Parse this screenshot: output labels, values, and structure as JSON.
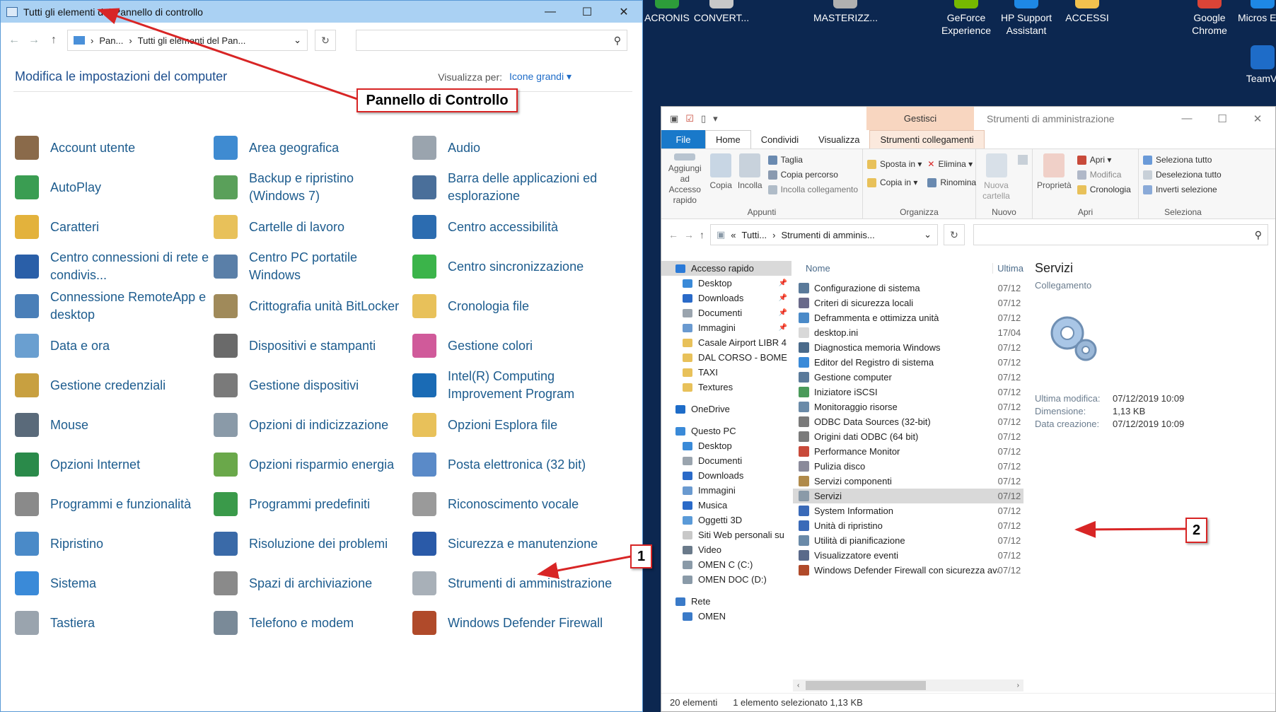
{
  "desktop_icons": [
    {
      "label": "ACRONIS",
      "color": "#2d9d3a"
    },
    {
      "label": "CONVERT...",
      "color": "#c8c8c8"
    },
    {
      "label": "MASTERIZZ...",
      "color": "#b0b0b0"
    },
    {
      "label": "GeForce Experience",
      "color": "#76b900"
    },
    {
      "label": "HP Support Assistant",
      "color": "#1e88e5"
    },
    {
      "label": "ACCESSI",
      "color": "#f2c14e"
    },
    {
      "label": "Google Chrome",
      "color": "#db4437"
    },
    {
      "label": "Micros Edg",
      "color": "#1e88e5"
    },
    {
      "label": "TeamVi",
      "color": "#1e6cc8"
    }
  ],
  "control_panel": {
    "title": "Tutti gli elementi del Pannello di controllo",
    "window_buttons": [
      "—",
      "☐",
      "✕"
    ],
    "breadcrumb": [
      "Pan...",
      "Tutti gli elementi del Pan..."
    ],
    "heading": "Modifica le impostazioni del computer",
    "view_label": "Visualizza per:",
    "view_value": "Icone grandi",
    "items": [
      {
        "label": "Account utente",
        "color": "#8a6a4a"
      },
      {
        "label": "Area geografica",
        "color": "#3f8bd1"
      },
      {
        "label": "Audio",
        "color": "#9aa4ae"
      },
      {
        "label": "AutoPlay",
        "color": "#3a9d52"
      },
      {
        "label": "Backup e ripristino (Windows 7)",
        "color": "#5aa05a"
      },
      {
        "label": "Barra delle applicazioni ed esplorazione",
        "color": "#4a6f9a"
      },
      {
        "label": "Caratteri",
        "color": "#e3b23c"
      },
      {
        "label": "Cartelle di lavoro",
        "color": "#e8c15a"
      },
      {
        "label": "Centro accessibilità",
        "color": "#2c6cb0"
      },
      {
        "label": "Centro connessioni di rete e condivis...",
        "color": "#2a5fa8"
      },
      {
        "label": "Centro PC portatile Windows",
        "color": "#5a7fa8"
      },
      {
        "label": "Centro sincronizzazione",
        "color": "#3bb44a"
      },
      {
        "label": "Connessione RemoteApp e desktop",
        "color": "#4a7fb8"
      },
      {
        "label": "Crittografia unità BitLocker",
        "color": "#a08a5a"
      },
      {
        "label": "Cronologia file",
        "color": "#e8c15a"
      },
      {
        "label": "Data e ora",
        "color": "#6a9fd0"
      },
      {
        "label": "Dispositivi e stampanti",
        "color": "#6a6a6a"
      },
      {
        "label": "Gestione colori",
        "color": "#d05a9a"
      },
      {
        "label": "Gestione credenziali",
        "color": "#c8a040"
      },
      {
        "label": "Gestione dispositivi",
        "color": "#7a7a7a"
      },
      {
        "label": "Intel(R) Computing Improvement Program",
        "color": "#1a6bb5"
      },
      {
        "label": "Mouse",
        "color": "#5a6a7a"
      },
      {
        "label": "Opzioni di indicizzazione",
        "color": "#8a9aa8"
      },
      {
        "label": "Opzioni Esplora file",
        "color": "#e8c15a"
      },
      {
        "label": "Opzioni Internet",
        "color": "#2a8a4a"
      },
      {
        "label": "Opzioni risparmio energia",
        "color": "#6aa84a"
      },
      {
        "label": "Posta elettronica (32 bit)",
        "color": "#5a8ac8"
      },
      {
        "label": "Programmi e funzionalità",
        "color": "#8a8a8a"
      },
      {
        "label": "Programmi predefiniti",
        "color": "#3a9a4a"
      },
      {
        "label": "Riconoscimento vocale",
        "color": "#9a9a9a"
      },
      {
        "label": "Ripristino",
        "color": "#4a8ac8"
      },
      {
        "label": "Risoluzione dei problemi",
        "color": "#3a6aa8"
      },
      {
        "label": "Sicurezza e manutenzione",
        "color": "#2a5aa8"
      },
      {
        "label": "Sistema",
        "color": "#3a8ad8"
      },
      {
        "label": "Spazi di archiviazione",
        "color": "#8a8a8a"
      },
      {
        "label": "Strumenti di amministrazione",
        "color": "#a8b0b8"
      },
      {
        "label": "Tastiera",
        "color": "#9aa4ae"
      },
      {
        "label": "Telefono e modem",
        "color": "#7a8a98"
      },
      {
        "label": "Windows Defender Firewall",
        "color": "#b04a2a"
      }
    ]
  },
  "explorer": {
    "quick_access_icons": [
      "folder-icon",
      "check-icon",
      "page-icon",
      "dropdown-icon"
    ],
    "contextual_tab": "Gestisci",
    "title": "Strumenti di amministrazione",
    "tabs": [
      "File",
      "Home",
      "Condividi",
      "Visualizza",
      "Strumenti collegamenti"
    ],
    "ribbon": {
      "appunti": {
        "group": "Appunti",
        "pin": "Aggiungi ad Accesso rapido",
        "copia": "Copia",
        "incolla": "Incolla",
        "taglia": "Taglia",
        "copia_percorso": "Copia percorso",
        "incolla_collegamento": "Incolla collegamento"
      },
      "organizza": {
        "group": "Organizza",
        "sposta": "Sposta in ▾",
        "copia_in": "Copia in ▾",
        "elimina": "Elimina ▾",
        "rinomina": "Rinomina"
      },
      "nuovo": {
        "group": "Nuovo",
        "nuova_cartella": "Nuova cartella"
      },
      "apri": {
        "group": "Apri",
        "proprieta": "Proprietà",
        "apri": "Apri ▾",
        "modifica": "Modifica",
        "cronologia": "Cronologia"
      },
      "seleziona": {
        "group": "Seleziona",
        "tutto": "Seleziona tutto",
        "deseleziona": "Deseleziona tutto",
        "inverti": "Inverti selezione"
      }
    },
    "breadcrumb": [
      "«",
      "Tutti...",
      "Strumenti di amminis..."
    ],
    "tree": [
      {
        "label": "Accesso rapido",
        "indent": 1,
        "sel": true,
        "color": "#2a7ad8",
        "pin": ""
      },
      {
        "label": "Desktop",
        "indent": 2,
        "color": "#3a8ad8",
        "pin": "📌"
      },
      {
        "label": "Downloads",
        "indent": 2,
        "color": "#2a6ac8",
        "pin": "📌"
      },
      {
        "label": "Documenti",
        "indent": 2,
        "color": "#9aa4ae",
        "pin": "📌"
      },
      {
        "label": "Immagini",
        "indent": 2,
        "color": "#6a9ad0",
        "pin": "📌"
      },
      {
        "label": "Casale Airport LIBR 4",
        "indent": 2,
        "color": "#e8c15a",
        "pin": ""
      },
      {
        "label": "DAL CORSO - BOME",
        "indent": 2,
        "color": "#e8c15a",
        "pin": ""
      },
      {
        "label": "TAXI",
        "indent": 2,
        "color": "#e8c15a",
        "pin": ""
      },
      {
        "label": "Textures",
        "indent": 2,
        "color": "#e8c15a",
        "pin": ""
      },
      {
        "label": "",
        "indent": 0,
        "color": "",
        "pin": "",
        "spacer": true
      },
      {
        "label": "OneDrive",
        "indent": 1,
        "color": "#1e6cc8",
        "pin": ""
      },
      {
        "label": "",
        "indent": 0,
        "color": "",
        "pin": "",
        "spacer": true
      },
      {
        "label": "Questo PC",
        "indent": 1,
        "color": "#3a8ad8",
        "pin": ""
      },
      {
        "label": "Desktop",
        "indent": 2,
        "color": "#3a8ad8",
        "pin": ""
      },
      {
        "label": "Documenti",
        "indent": 2,
        "color": "#9aa4ae",
        "pin": ""
      },
      {
        "label": "Downloads",
        "indent": 2,
        "color": "#2a6ac8",
        "pin": ""
      },
      {
        "label": "Immagini",
        "indent": 2,
        "color": "#6a9ad0",
        "pin": ""
      },
      {
        "label": "Musica",
        "indent": 2,
        "color": "#2a6ac8",
        "pin": ""
      },
      {
        "label": "Oggetti 3D",
        "indent": 2,
        "color": "#5a9ad8",
        "pin": ""
      },
      {
        "label": "Siti Web personali su",
        "indent": 2,
        "color": "#c8c8c8",
        "pin": ""
      },
      {
        "label": "Video",
        "indent": 2,
        "color": "#6a7a8a",
        "pin": ""
      },
      {
        "label": "OMEN C (C:)",
        "indent": 2,
        "color": "#8a9aa8",
        "pin": ""
      },
      {
        "label": "OMEN DOC (D:)",
        "indent": 2,
        "color": "#8a9aa8",
        "pin": ""
      },
      {
        "label": "",
        "indent": 0,
        "color": "",
        "pin": "",
        "spacer": true
      },
      {
        "label": "Rete",
        "indent": 1,
        "color": "#3a7ac8",
        "pin": ""
      },
      {
        "label": "OMEN",
        "indent": 2,
        "color": "#3a7ac8",
        "pin": ""
      }
    ],
    "columns": {
      "name": "Nome",
      "date": "Ultima"
    },
    "files": [
      {
        "name": "Configurazione di sistema",
        "date": "07/12",
        "color": "#5a7a9a"
      },
      {
        "name": "Criteri di sicurezza locali",
        "date": "07/12",
        "color": "#6a6a8a"
      },
      {
        "name": "Deframmenta e ottimizza unità",
        "date": "07/12",
        "color": "#4a8ac8"
      },
      {
        "name": "desktop.ini",
        "date": "17/04",
        "color": "#d8d8d8"
      },
      {
        "name": "Diagnostica memoria Windows",
        "date": "07/12",
        "color": "#4a6a8a"
      },
      {
        "name": "Editor del Registro di sistema",
        "date": "07/12",
        "color": "#3a8ad8"
      },
      {
        "name": "Gestione computer",
        "date": "07/12",
        "color": "#5a7a9a"
      },
      {
        "name": "Iniziatore iSCSI",
        "date": "07/12",
        "color": "#4a9a5a"
      },
      {
        "name": "Monitoraggio risorse",
        "date": "07/12",
        "color": "#6a8aa8"
      },
      {
        "name": "ODBC Data Sources (32-bit)",
        "date": "07/12",
        "color": "#7a7a7a"
      },
      {
        "name": "Origini dati ODBC (64 bit)",
        "date": "07/12",
        "color": "#7a7a7a"
      },
      {
        "name": "Performance Monitor",
        "date": "07/12",
        "color": "#c84a3a"
      },
      {
        "name": "Pulizia disco",
        "date": "07/12",
        "color": "#8a8a9a"
      },
      {
        "name": "Servizi componenti",
        "date": "07/12",
        "color": "#b08a4a"
      },
      {
        "name": "Servizi",
        "date": "07/12",
        "color": "#8a9aa8",
        "sel": true
      },
      {
        "name": "System Information",
        "date": "07/12",
        "color": "#3a6ab8"
      },
      {
        "name": "Unità di ripristino",
        "date": "07/12",
        "color": "#3a6ab8"
      },
      {
        "name": "Utilità di pianificazione",
        "date": "07/12",
        "color": "#6a8aa8"
      },
      {
        "name": "Visualizzatore eventi",
        "date": "07/12",
        "color": "#5a6a8a"
      },
      {
        "name": "Windows Defender Firewall con sicurezza avan...",
        "date": "07/12",
        "color": "#b04a2a"
      }
    ],
    "preview": {
      "title": "Servizi",
      "type": "Collegamento",
      "props": [
        {
          "k": "Ultima modifica:",
          "v": "07/12/2019 10:09"
        },
        {
          "k": "Dimensione:",
          "v": "1,13 KB"
        },
        {
          "k": "Data creazione:",
          "v": "07/12/2019 10:09"
        }
      ]
    },
    "status": {
      "count": "20 elementi",
      "selection": "1 elemento selezionato  1,13 KB"
    }
  },
  "annotations": {
    "pannello": "Pannello di Controllo",
    "one": "1",
    "two": "2",
    "color": "#d82525"
  }
}
